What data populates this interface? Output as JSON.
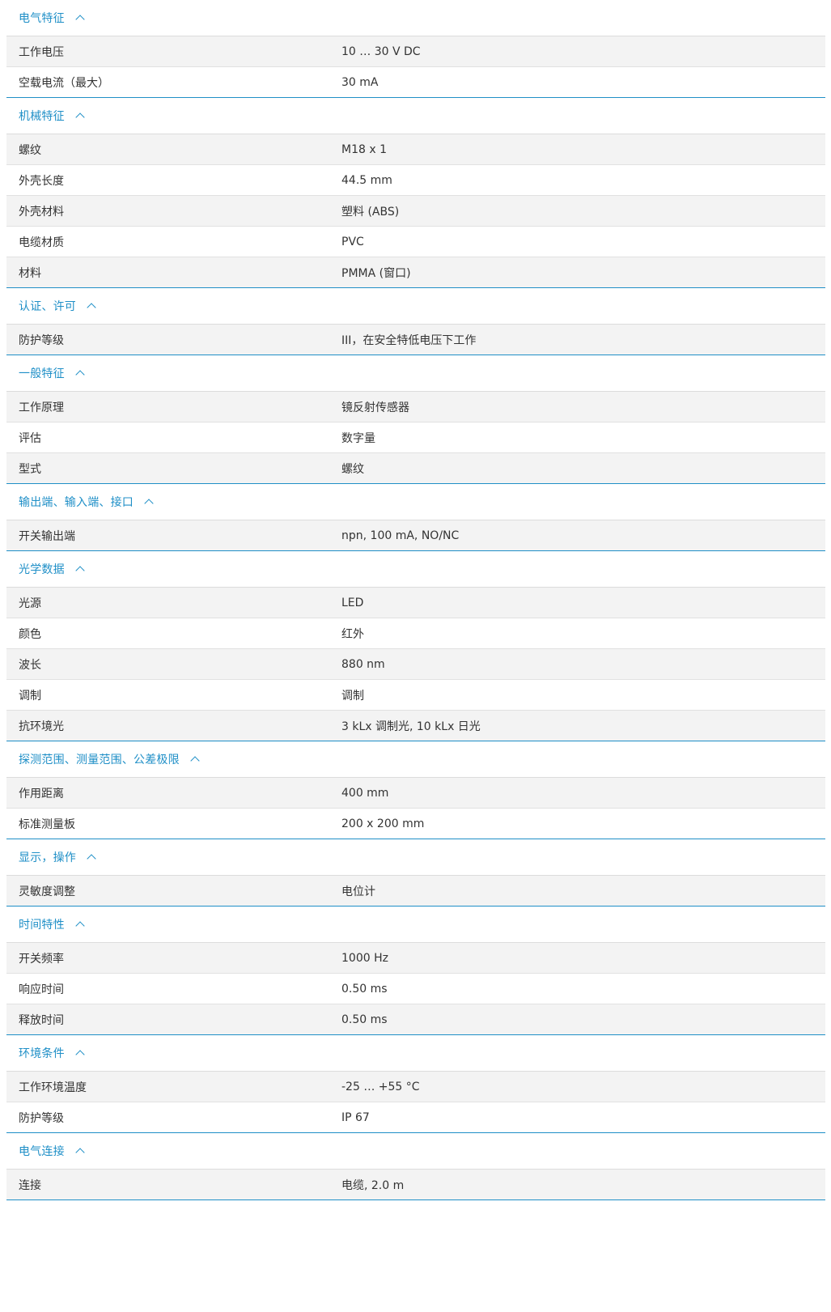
{
  "icons": {
    "collapse": "chevron-up-icon"
  },
  "colors": {
    "accent": "#1f8fc7",
    "row_shade": "#f3f3f3",
    "text": "#333333"
  },
  "sections": [
    {
      "title": "电气特征",
      "rows": [
        {
          "label": "工作电压",
          "value": "10 … 30 V DC"
        },
        {
          "label": "空载电流（最大）",
          "value": "30 mA"
        }
      ]
    },
    {
      "title": "机械特征",
      "rows": [
        {
          "label": "螺纹",
          "value": "M18 x 1"
        },
        {
          "label": "外壳长度",
          "value": "44.5 mm"
        },
        {
          "label": "外壳材料",
          "value": "塑料 (ABS)"
        },
        {
          "label": "电缆材质",
          "value": "PVC"
        },
        {
          "label": "材料",
          "value": "PMMA (窗口)"
        }
      ]
    },
    {
      "title": "认证、许可",
      "rows": [
        {
          "label": "防护等级",
          "value": "III，在安全特低电压下工作"
        }
      ]
    },
    {
      "title": "一般特征",
      "rows": [
        {
          "label": "工作原理",
          "value": "镜反射传感器"
        },
        {
          "label": "评估",
          "value": "数字量"
        },
        {
          "label": "型式",
          "value": "螺纹"
        }
      ]
    },
    {
      "title": "输出端、输入端、接口",
      "rows": [
        {
          "label": "开关输出端",
          "value": "npn, 100 mA, NO/NC"
        }
      ]
    },
    {
      "title": "光学数据",
      "rows": [
        {
          "label": "光源",
          "value": "LED"
        },
        {
          "label": "颜色",
          "value": "红外"
        },
        {
          "label": "波长",
          "value": "880 nm"
        },
        {
          "label": "调制",
          "value": "调制"
        },
        {
          "label": "抗环境光",
          "value": "3 kLx 调制光, 10 kLx 日光"
        }
      ]
    },
    {
      "title": "探测范围、测量范围、公差极限",
      "rows": [
        {
          "label": "作用距离",
          "value": "400 mm"
        },
        {
          "label": "标准测量板",
          "value": "200 x 200 mm"
        }
      ]
    },
    {
      "title": "显示，操作",
      "rows": [
        {
          "label": "灵敏度调整",
          "value": "电位计"
        }
      ]
    },
    {
      "title": "时间特性",
      "rows": [
        {
          "label": "开关频率",
          "value": "1000 Hz"
        },
        {
          "label": "响应时间",
          "value": "0.50 ms"
        },
        {
          "label": "释放时间",
          "value": "0.50 ms"
        }
      ]
    },
    {
      "title": "环境条件",
      "rows": [
        {
          "label": "工作环境温度",
          "value": "-25 … +55 °C"
        },
        {
          "label": "防护等级",
          "value": "IP 67"
        }
      ]
    },
    {
      "title": "电气连接",
      "rows": [
        {
          "label": "连接",
          "value": "电缆, 2.0 m"
        }
      ]
    }
  ]
}
